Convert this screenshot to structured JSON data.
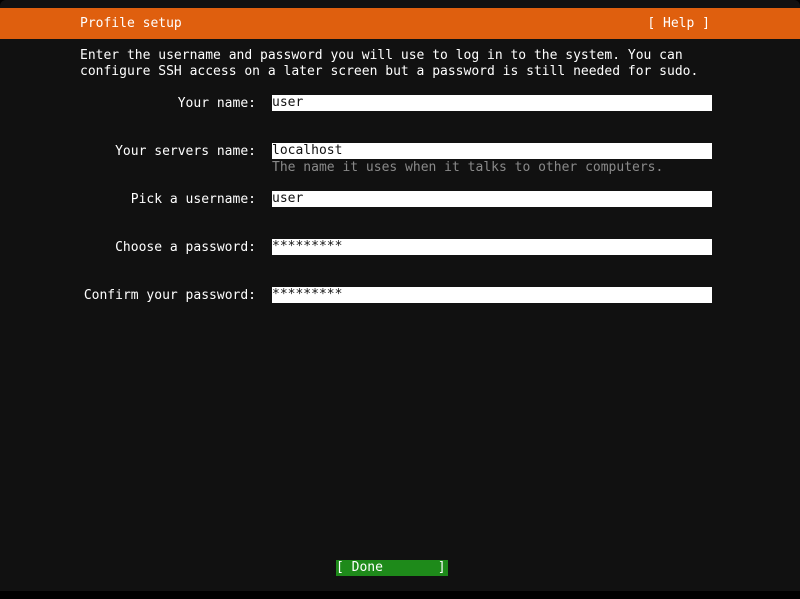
{
  "header": {
    "title": "Profile setup",
    "help_label": "[ Help ]"
  },
  "intro": {
    "line1": "Enter the username and password you will use to log in to the system. You can",
    "line2": "configure SSH access on a later screen but a password is still needed for sudo."
  },
  "form": {
    "your_name": {
      "label": "Your name:",
      "value": "user"
    },
    "server_name": {
      "label": "Your servers name:",
      "value": "localhost",
      "hint": "The name it uses when it talks to other computers."
    },
    "username": {
      "label": "Pick a username:",
      "value": "user"
    },
    "password": {
      "label": "Choose a password:",
      "value": "*********"
    },
    "confirm_password": {
      "label": "Confirm your password:",
      "value": "*********"
    }
  },
  "footer": {
    "done_label": "[ Done       ]"
  },
  "colors": {
    "header_bg": "#df5f0e",
    "background": "#111111",
    "done_bg": "#1e8a1a",
    "hint_text": "#8a8a8a"
  }
}
